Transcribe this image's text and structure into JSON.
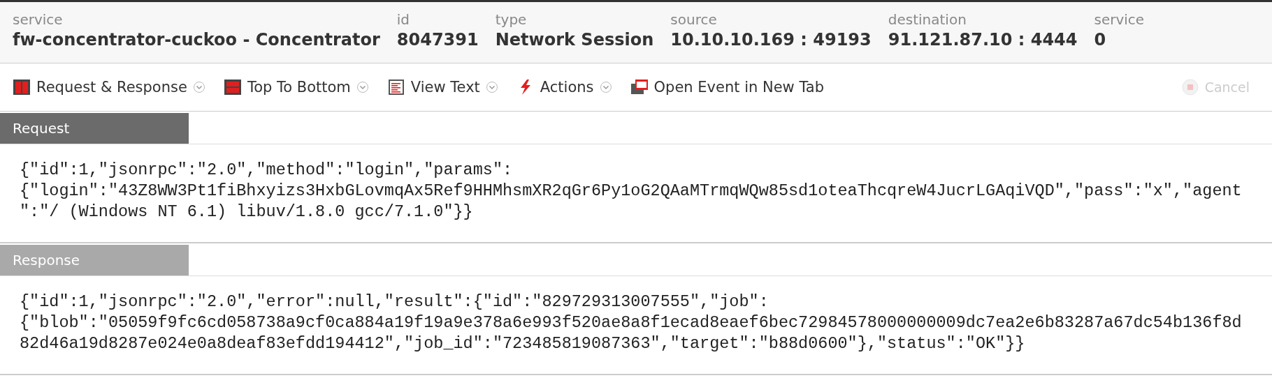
{
  "header": {
    "fields": [
      {
        "label": "service",
        "value": "fw-concentrator-cuckoo - Concentrator"
      },
      {
        "label": "id",
        "value": "8047391"
      },
      {
        "label": "type",
        "value": "Network Session"
      },
      {
        "label": "source",
        "value": "10.10.10.169 : 49193"
      },
      {
        "label": "destination",
        "value": "91.121.87.10 : 4444"
      },
      {
        "label": "service",
        "value": "0"
      }
    ]
  },
  "toolbar": {
    "items": [
      {
        "label": "Request & Response",
        "kind": "split",
        "dropdown": true
      },
      {
        "label": "Top To Bottom",
        "kind": "stacked",
        "dropdown": true
      },
      {
        "label": "View Text",
        "kind": "text",
        "dropdown": true
      },
      {
        "label": "Actions",
        "kind": "bolt",
        "dropdown": true
      },
      {
        "label": "Open Event in New Tab",
        "kind": "newtab",
        "dropdown": false
      }
    ],
    "cancel": {
      "label": "Cancel",
      "disabled": true
    }
  },
  "sections": [
    {
      "title": "Request",
      "kind": "request",
      "lines": [
        "{\"id\":1,\"jsonrpc\":\"2.0\",\"method\":\"login\",\"params\":",
        "{\"login\":\"43Z8WW3Pt1fiBhxyizs3HxbGLovmqAx5Ref9HHMhsmXR2qGr6Py1oG2QAaMTrmqWQw85sd1oteaThcqreW4JucrLGAqiVQD\",\"pass\":\"x\",\"agent",
        "\":\"/ (Windows NT 6.1) libuv/1.8.0 gcc/7.1.0\"}}"
      ]
    },
    {
      "title": "Response",
      "kind": "response",
      "lines": [
        "{\"id\":1,\"jsonrpc\":\"2.0\",\"error\":null,\"result\":{\"id\":\"829729313007555\",\"job\":",
        "{\"blob\":\"05059f9fc6cd058738a9cf0ca884a19f19a9e378a6e993f520ae8a8f1ecad8eaef6bec72984578000000009dc7ea2e6b83287a67dc54b136f8d",
        "82d46a19d8287e024e0a8deaf83efdd194412\",\"job_id\":\"723485819087363\",\"target\":\"b88d0600\"},\"status\":\"OK\"}}"
      ]
    }
  ]
}
